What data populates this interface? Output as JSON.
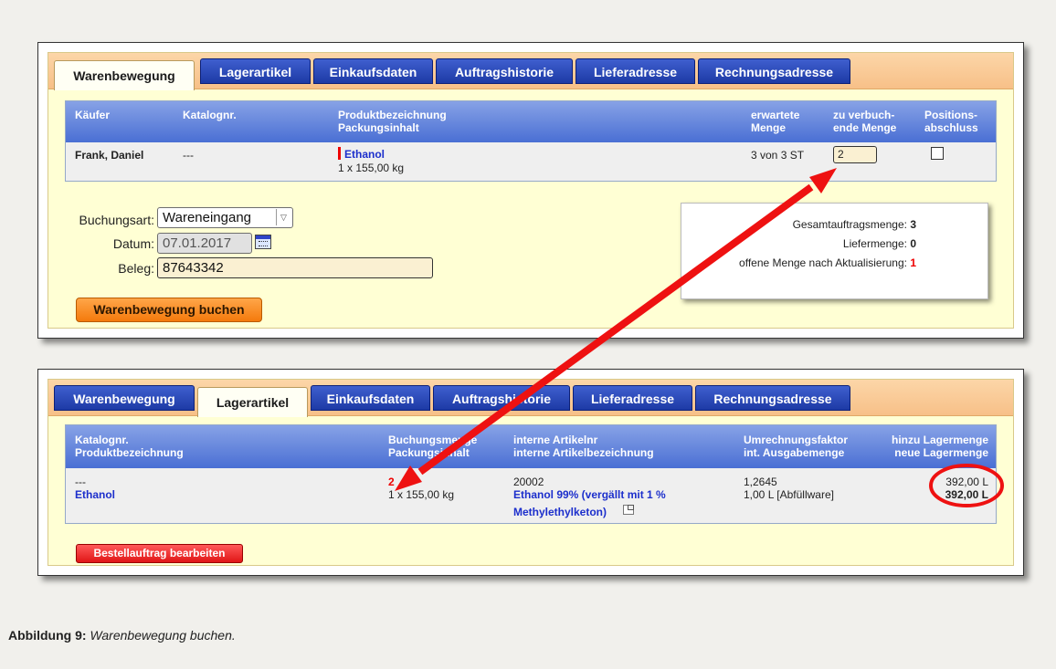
{
  "tabs": [
    "Warenbewegung",
    "Lagerartikel",
    "Einkaufsdaten",
    "Auftragshistorie",
    "Lieferadresse",
    "Rechnungsadresse"
  ],
  "panel1": {
    "headers": {
      "kaeufer": "Käufer",
      "katalognr": "Katalognr.",
      "produkt1": "Produktbezeichnung",
      "produkt2": "Packungsinhalt",
      "erwartete1": "erwartete",
      "erwartete2": "Menge",
      "verbuch1": "zu verbuch-",
      "verbuch2": "ende Menge",
      "position1": "Positions-",
      "position2": "abschluss"
    },
    "row": {
      "kaeufer": "Frank, Daniel",
      "katalognr": "---",
      "produkt": "Ethanol",
      "packung": "1 x 155,00 kg",
      "erwartete": "3 von 3 ST",
      "menge_value": "2"
    },
    "form": {
      "buchungsart_label": "Buchungsart:",
      "buchungsart_value": "Wareneingang",
      "datum_label": "Datum:",
      "datum_value": "07.01.2017",
      "beleg_label": "Beleg:",
      "beleg_value": "87643342"
    },
    "popup": {
      "gesamt_label": "Gesamtauftragsmenge:",
      "gesamt_value": "3",
      "liefer_label": "Liefermenge:",
      "liefer_value": "0",
      "offen_label": "offene Menge nach Aktualisierung:",
      "offen_value": "1"
    },
    "button": "Warenbewegung buchen"
  },
  "panel2": {
    "headers": {
      "katalognr": "Katalognr.",
      "produkt": "Produktbezeichnung",
      "buchung1": "Buchungsmenge",
      "buchung2": "Packungsinhalt",
      "intern1": "interne Artikelnr",
      "intern2": "interne Artikelbezeichnung",
      "umrech1": "Umrechnungsfaktor",
      "umrech2": "int. Ausgabemenge",
      "hinzu1": "hinzu Lagermenge",
      "hinzu2": "neue Lagermenge"
    },
    "row": {
      "katalognr": "---",
      "produkt": "Ethanol",
      "buchung": "2",
      "packung": "1 x 155,00 kg",
      "artikelnr": "20002",
      "bezeichnung1": "Ethanol 99% (vergällt mit 1 %",
      "bezeichnung2": "Methylethylketon)",
      "faktor": "1,2645",
      "ausgabe": "1,00 L [Abfüllware]",
      "hinzu": "392,00 L",
      "neu": "392,00 L"
    },
    "button": "Bestellauftrag bearbeiten"
  },
  "caption": {
    "label": "Abbildung 9:",
    "text": "Warenbewegung buchen."
  },
  "colors": {
    "annotation": "#ee1111",
    "tab_blue": "#2a47b8",
    "header_blue": "#5a7dd8",
    "panel_yellow": "#ffffd4",
    "tabbar_orange": "#f9c891"
  }
}
